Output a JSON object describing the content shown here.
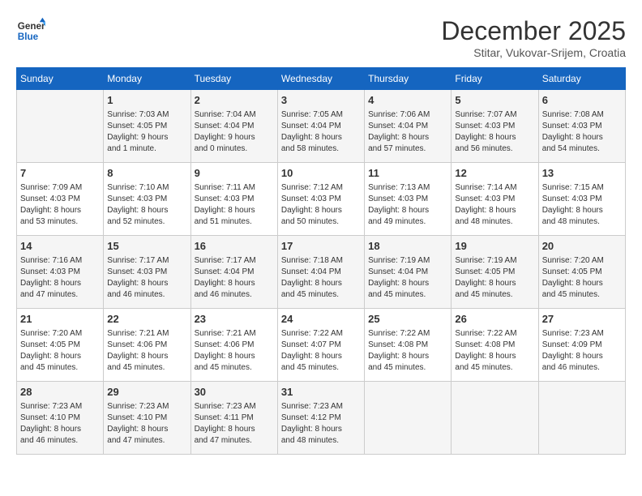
{
  "logo": {
    "line1": "General",
    "line2": "Blue"
  },
  "title": "December 2025",
  "location": "Stitar, Vukovar-Srijem, Croatia",
  "days_header": [
    "Sunday",
    "Monday",
    "Tuesday",
    "Wednesday",
    "Thursday",
    "Friday",
    "Saturday"
  ],
  "weeks": [
    [
      {
        "day": "",
        "info": ""
      },
      {
        "day": "1",
        "info": "Sunrise: 7:03 AM\nSunset: 4:05 PM\nDaylight: 9 hours\nand 1 minute."
      },
      {
        "day": "2",
        "info": "Sunrise: 7:04 AM\nSunset: 4:04 PM\nDaylight: 9 hours\nand 0 minutes."
      },
      {
        "day": "3",
        "info": "Sunrise: 7:05 AM\nSunset: 4:04 PM\nDaylight: 8 hours\nand 58 minutes."
      },
      {
        "day": "4",
        "info": "Sunrise: 7:06 AM\nSunset: 4:04 PM\nDaylight: 8 hours\nand 57 minutes."
      },
      {
        "day": "5",
        "info": "Sunrise: 7:07 AM\nSunset: 4:03 PM\nDaylight: 8 hours\nand 56 minutes."
      },
      {
        "day": "6",
        "info": "Sunrise: 7:08 AM\nSunset: 4:03 PM\nDaylight: 8 hours\nand 54 minutes."
      }
    ],
    [
      {
        "day": "7",
        "info": "Sunrise: 7:09 AM\nSunset: 4:03 PM\nDaylight: 8 hours\nand 53 minutes."
      },
      {
        "day": "8",
        "info": "Sunrise: 7:10 AM\nSunset: 4:03 PM\nDaylight: 8 hours\nand 52 minutes."
      },
      {
        "day": "9",
        "info": "Sunrise: 7:11 AM\nSunset: 4:03 PM\nDaylight: 8 hours\nand 51 minutes."
      },
      {
        "day": "10",
        "info": "Sunrise: 7:12 AM\nSunset: 4:03 PM\nDaylight: 8 hours\nand 50 minutes."
      },
      {
        "day": "11",
        "info": "Sunrise: 7:13 AM\nSunset: 4:03 PM\nDaylight: 8 hours\nand 49 minutes."
      },
      {
        "day": "12",
        "info": "Sunrise: 7:14 AM\nSunset: 4:03 PM\nDaylight: 8 hours\nand 48 minutes."
      },
      {
        "day": "13",
        "info": "Sunrise: 7:15 AM\nSunset: 4:03 PM\nDaylight: 8 hours\nand 48 minutes."
      }
    ],
    [
      {
        "day": "14",
        "info": "Sunrise: 7:16 AM\nSunset: 4:03 PM\nDaylight: 8 hours\nand 47 minutes."
      },
      {
        "day": "15",
        "info": "Sunrise: 7:17 AM\nSunset: 4:03 PM\nDaylight: 8 hours\nand 46 minutes."
      },
      {
        "day": "16",
        "info": "Sunrise: 7:17 AM\nSunset: 4:04 PM\nDaylight: 8 hours\nand 46 minutes."
      },
      {
        "day": "17",
        "info": "Sunrise: 7:18 AM\nSunset: 4:04 PM\nDaylight: 8 hours\nand 45 minutes."
      },
      {
        "day": "18",
        "info": "Sunrise: 7:19 AM\nSunset: 4:04 PM\nDaylight: 8 hours\nand 45 minutes."
      },
      {
        "day": "19",
        "info": "Sunrise: 7:19 AM\nSunset: 4:05 PM\nDaylight: 8 hours\nand 45 minutes."
      },
      {
        "day": "20",
        "info": "Sunrise: 7:20 AM\nSunset: 4:05 PM\nDaylight: 8 hours\nand 45 minutes."
      }
    ],
    [
      {
        "day": "21",
        "info": "Sunrise: 7:20 AM\nSunset: 4:05 PM\nDaylight: 8 hours\nand 45 minutes."
      },
      {
        "day": "22",
        "info": "Sunrise: 7:21 AM\nSunset: 4:06 PM\nDaylight: 8 hours\nand 45 minutes."
      },
      {
        "day": "23",
        "info": "Sunrise: 7:21 AM\nSunset: 4:06 PM\nDaylight: 8 hours\nand 45 minutes."
      },
      {
        "day": "24",
        "info": "Sunrise: 7:22 AM\nSunset: 4:07 PM\nDaylight: 8 hours\nand 45 minutes."
      },
      {
        "day": "25",
        "info": "Sunrise: 7:22 AM\nSunset: 4:08 PM\nDaylight: 8 hours\nand 45 minutes."
      },
      {
        "day": "26",
        "info": "Sunrise: 7:22 AM\nSunset: 4:08 PM\nDaylight: 8 hours\nand 45 minutes."
      },
      {
        "day": "27",
        "info": "Sunrise: 7:23 AM\nSunset: 4:09 PM\nDaylight: 8 hours\nand 46 minutes."
      }
    ],
    [
      {
        "day": "28",
        "info": "Sunrise: 7:23 AM\nSunset: 4:10 PM\nDaylight: 8 hours\nand 46 minutes."
      },
      {
        "day": "29",
        "info": "Sunrise: 7:23 AM\nSunset: 4:10 PM\nDaylight: 8 hours\nand 47 minutes."
      },
      {
        "day": "30",
        "info": "Sunrise: 7:23 AM\nSunset: 4:11 PM\nDaylight: 8 hours\nand 47 minutes."
      },
      {
        "day": "31",
        "info": "Sunrise: 7:23 AM\nSunset: 4:12 PM\nDaylight: 8 hours\nand 48 minutes."
      },
      {
        "day": "",
        "info": ""
      },
      {
        "day": "",
        "info": ""
      },
      {
        "day": "",
        "info": ""
      }
    ]
  ]
}
